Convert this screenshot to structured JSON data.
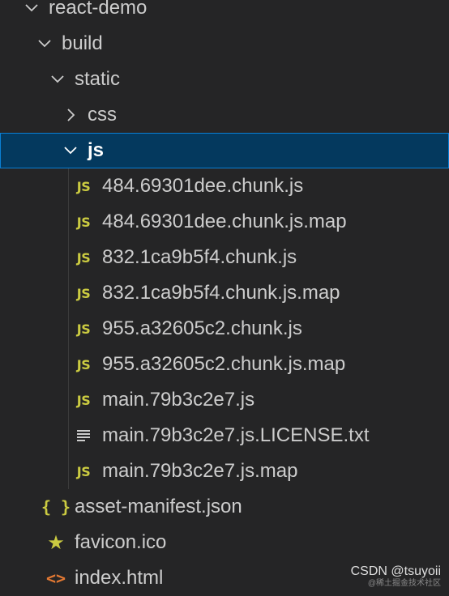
{
  "explorer": {
    "root": "react-demo",
    "build": "build",
    "static": "static",
    "css": "css",
    "js": "js",
    "js_files": [
      "484.69301dee.chunk.js",
      "484.69301dee.chunk.js.map",
      "832.1ca9b5f4.chunk.js",
      "832.1ca9b5f4.chunk.js.map",
      "955.a32605c2.chunk.js",
      "955.a32605c2.chunk.js.map",
      "main.79b3c2e7.js",
      "main.79b3c2e7.js.LICENSE.txt",
      "main.79b3c2e7.js.map"
    ],
    "build_files": [
      "asset-manifest.json",
      "favicon.ico",
      "index.html"
    ]
  },
  "icons": {
    "js_badge": "JS",
    "json_badge": "{ }",
    "star_badge": "★",
    "html_badge": "<>"
  },
  "watermark": {
    "main": "CSDN @tsuyoii",
    "sub": "@稀土掘金技术社区"
  },
  "colors": {
    "background": "#252526",
    "selection_bg": "#04395e",
    "selection_border": "#0a7fd4",
    "js_icon": "#cbcb41",
    "html_icon": "#e37933",
    "text": "#cccccc"
  }
}
